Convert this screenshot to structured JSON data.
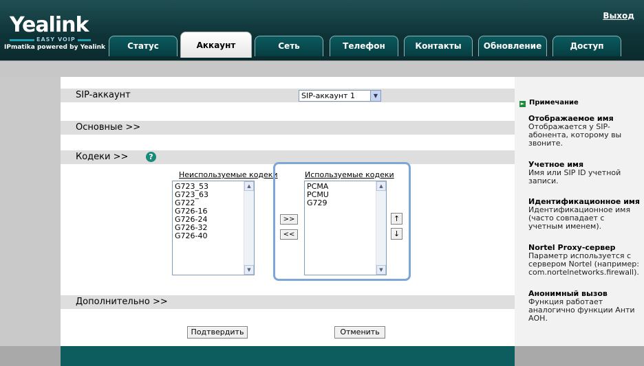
{
  "header": {
    "logo_word": "Yealink",
    "logo_sub": "EASY VOIP",
    "powered": "IPmatika powered by Yealink",
    "logout": "Выход"
  },
  "tabs": [
    {
      "label": "Статус"
    },
    {
      "label": "Аккаунт"
    },
    {
      "label": "Сеть"
    },
    {
      "label": "Телефон"
    },
    {
      "label": "Контакты"
    },
    {
      "label": "Обновление"
    },
    {
      "label": "Доступ"
    }
  ],
  "active_tab": "Аккаунт",
  "sections": {
    "sip": "SIP-аккаунт",
    "basic": "Основные >>",
    "codecs": "Кодеки >>",
    "more": "Дополнительно >>"
  },
  "sip_select": {
    "value": "SIP-аккаунт 1"
  },
  "codecs": {
    "unused_title": "Неиспользуемые кодеки",
    "unused": [
      "G723_53",
      "G723_63",
      "G722",
      "G726-16",
      "G726-24",
      "G726-32",
      "G726-40"
    ],
    "used_title": "Используемые кодеки",
    "used": [
      "PCMA",
      "PCMU",
      "G729"
    ],
    "add_label": ">>",
    "remove_label": "<<",
    "up_label": "↑",
    "down_label": "↓"
  },
  "buttons": {
    "confirm": "Подтвердить",
    "cancel": "Отменить"
  },
  "note": {
    "heading": "Примечание",
    "items": [
      {
        "title": "Отображаемое имя",
        "text": "Отображается у SIP-абонента, которому вы звоните."
      },
      {
        "title": "Учетное имя",
        "text": "Имя или SIP ID учетной записи."
      },
      {
        "title": "Идентификационное имя",
        "text": "Идентификационное имя (часто совпадает с учетным именем)."
      },
      {
        "title": "Nortel Proxy-сервер",
        "text": "Параметр используется с сервером Nortel (например: com.nortelnetworks.firewall)."
      },
      {
        "title": "Анонимный вызов",
        "text": "Функция работает аналогично функции Анти АОН."
      }
    ]
  },
  "colors": {
    "header": "#0e3337",
    "footer": "#0d5c5e",
    "section": "#dedede",
    "frame": "#7ea6d8"
  }
}
